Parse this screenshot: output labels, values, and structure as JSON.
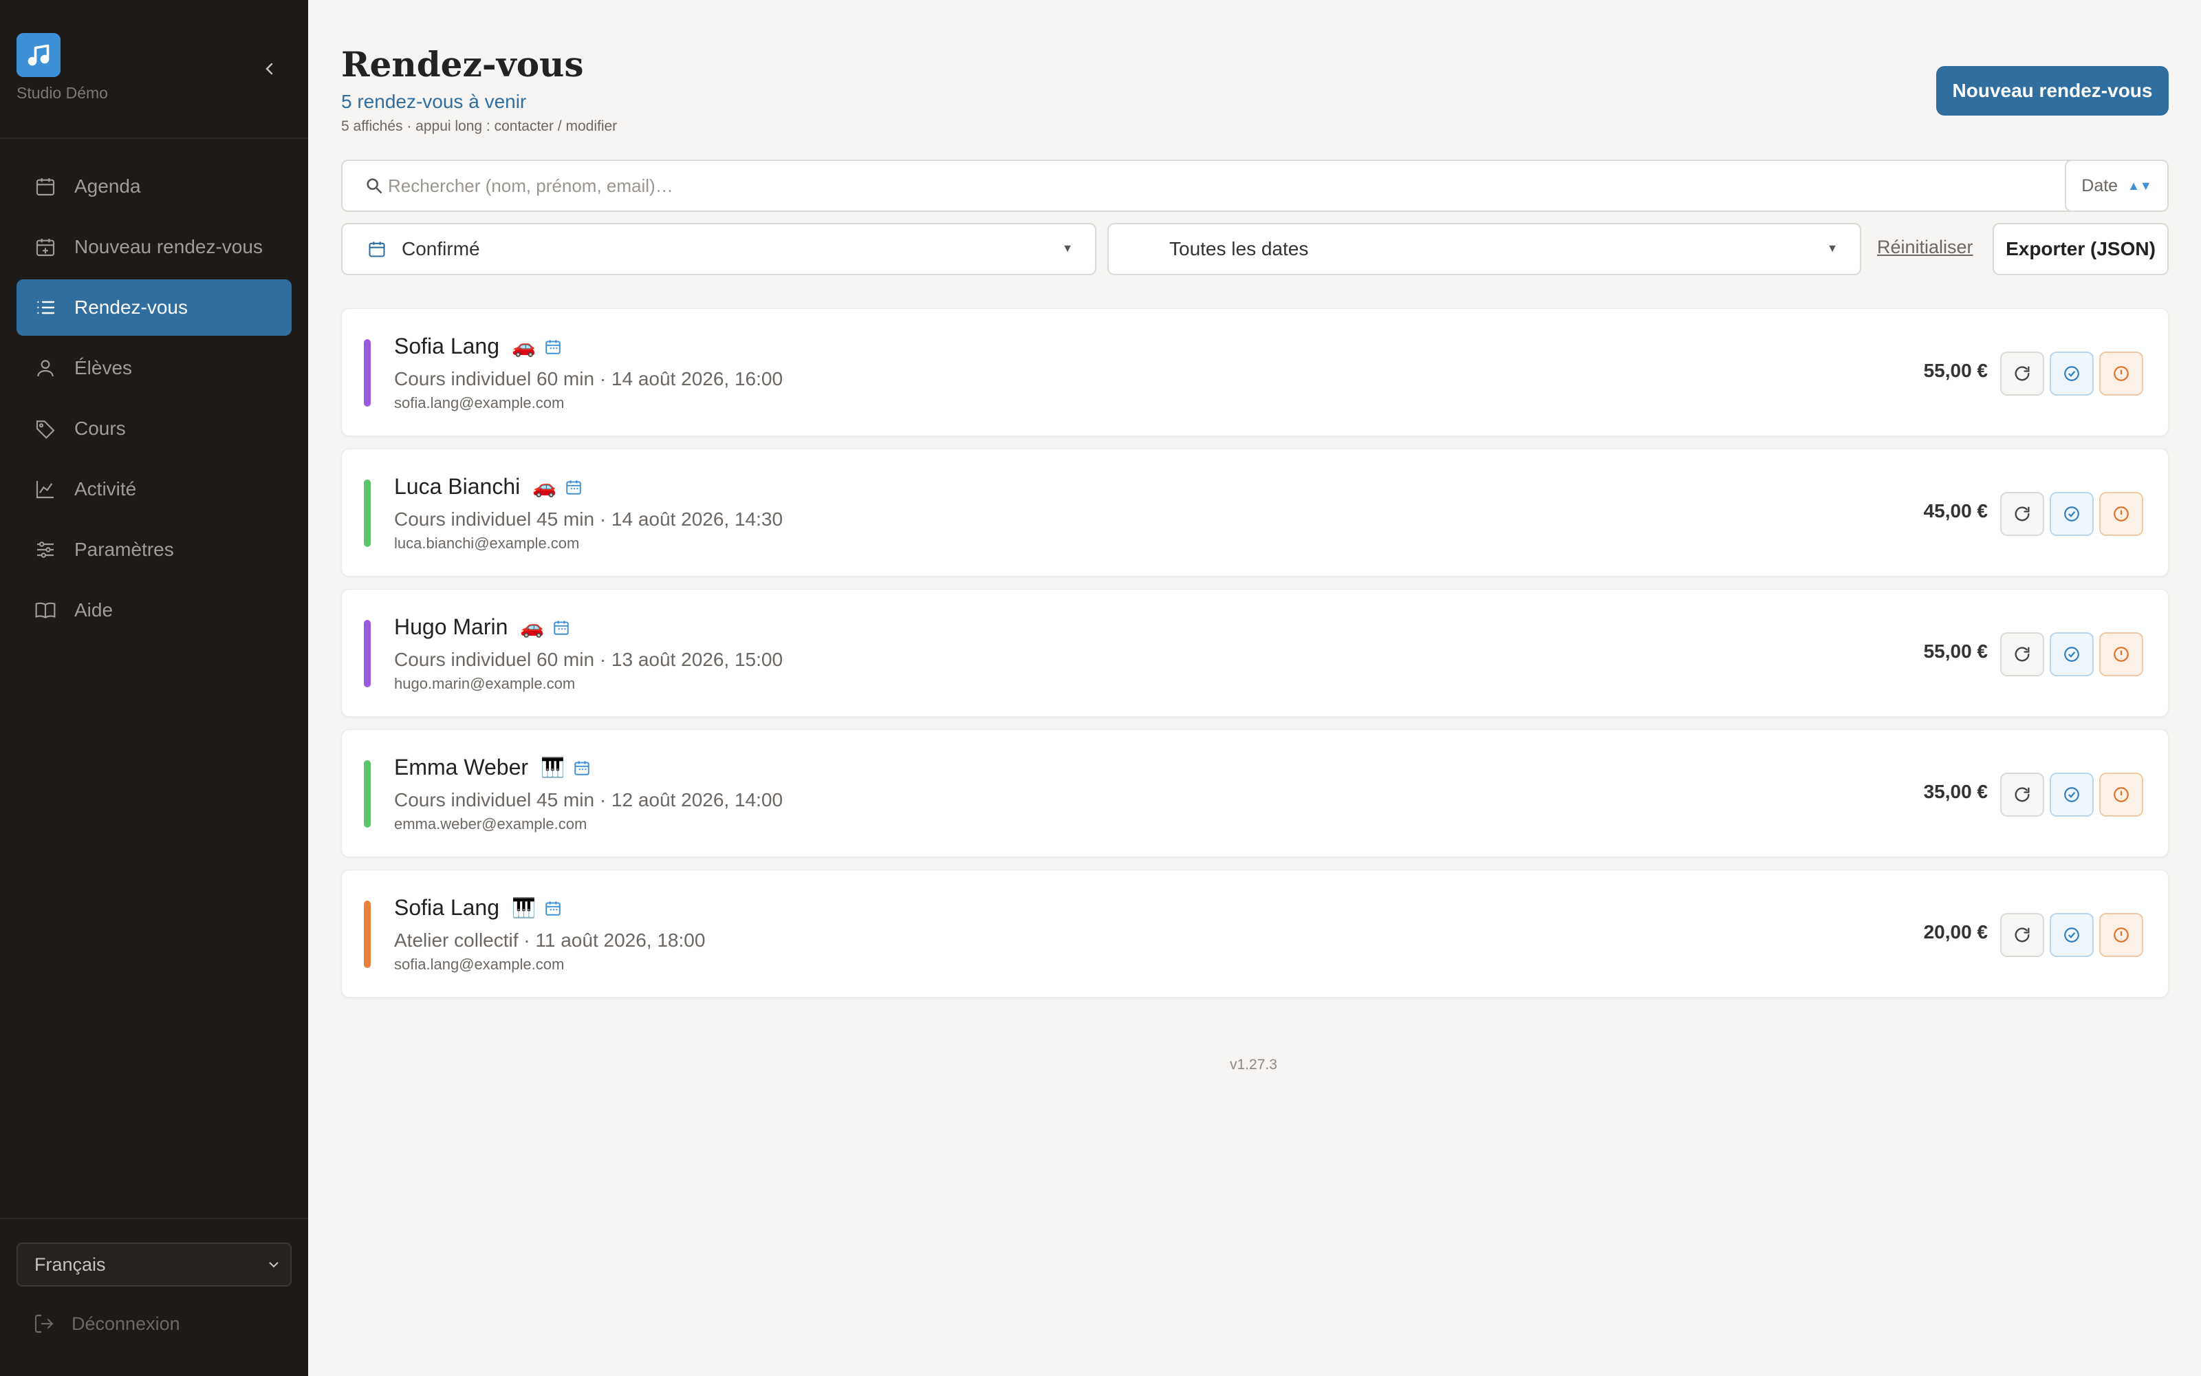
{
  "sidebar": {
    "studio_name": "Studio Démo",
    "items": [
      {
        "label": "Agenda",
        "icon": "calendar-icon"
      },
      {
        "label": "Nouveau rendez-vous",
        "icon": "calendar-plus-icon"
      },
      {
        "label": "Rendez-vous",
        "icon": "list-icon",
        "active": true
      },
      {
        "label": "Élèves",
        "icon": "user-icon"
      },
      {
        "label": "Cours",
        "icon": "tag-icon"
      },
      {
        "label": "Activité",
        "icon": "chart-line-icon"
      },
      {
        "label": "Paramètres",
        "icon": "sliders-icon"
      },
      {
        "label": "Aide",
        "icon": "book-icon"
      }
    ],
    "language": "Français",
    "logout": "Déconnexion"
  },
  "header": {
    "title": "Rendez-vous",
    "subtitle": "5 rendez-vous à venir",
    "hint": "5 affichés · appui long : contacter / modifier",
    "new_button": "Nouveau rendez-vous"
  },
  "toolbar": {
    "search_placeholder": "Rechercher (nom, prénom, email)…",
    "sort_label": "Date",
    "status_filter": "Confirmé",
    "date_filter": "Toutes les dates",
    "reset_label": "Réinitialiser",
    "export_label": "Exporter (JSON)"
  },
  "appointments": [
    {
      "name": "Sofia Lang",
      "emoji": "🚗",
      "detail": "Cours individuel 60 min · 14 août 2026, 16:00",
      "email": "sofia.lang@example.com",
      "price": "55,00 €",
      "color": "#9b59e0"
    },
    {
      "name": "Luca Bianchi",
      "emoji": "🚗",
      "detail": "Cours individuel 45 min · 14 août 2026, 14:30",
      "email": "luca.bianchi@example.com",
      "price": "45,00 €",
      "color": "#5cc46a"
    },
    {
      "name": "Hugo Marin",
      "emoji": "🚗",
      "detail": "Cours individuel 60 min · 13 août 2026, 15:00",
      "email": "hugo.marin@example.com",
      "price": "55,00 €",
      "color": "#9b59e0"
    },
    {
      "name": "Emma Weber",
      "emoji": "🎹",
      "detail": "Cours individuel 45 min · 12 août 2026, 14:00",
      "email": "emma.weber@example.com",
      "price": "35,00 €",
      "color": "#5cc46a"
    },
    {
      "name": "Sofia Lang",
      "emoji": "🎹",
      "detail": "Atelier collectif · 11 août 2026, 18:00",
      "email": "sofia.lang@example.com",
      "price": "20,00 €",
      "color": "#e8823a"
    }
  ],
  "version": "v1.27.3",
  "colors": {
    "accent": "#2f6e9e",
    "sidebar_bg": "#1d1a18",
    "logo": "#3d8fd6"
  }
}
